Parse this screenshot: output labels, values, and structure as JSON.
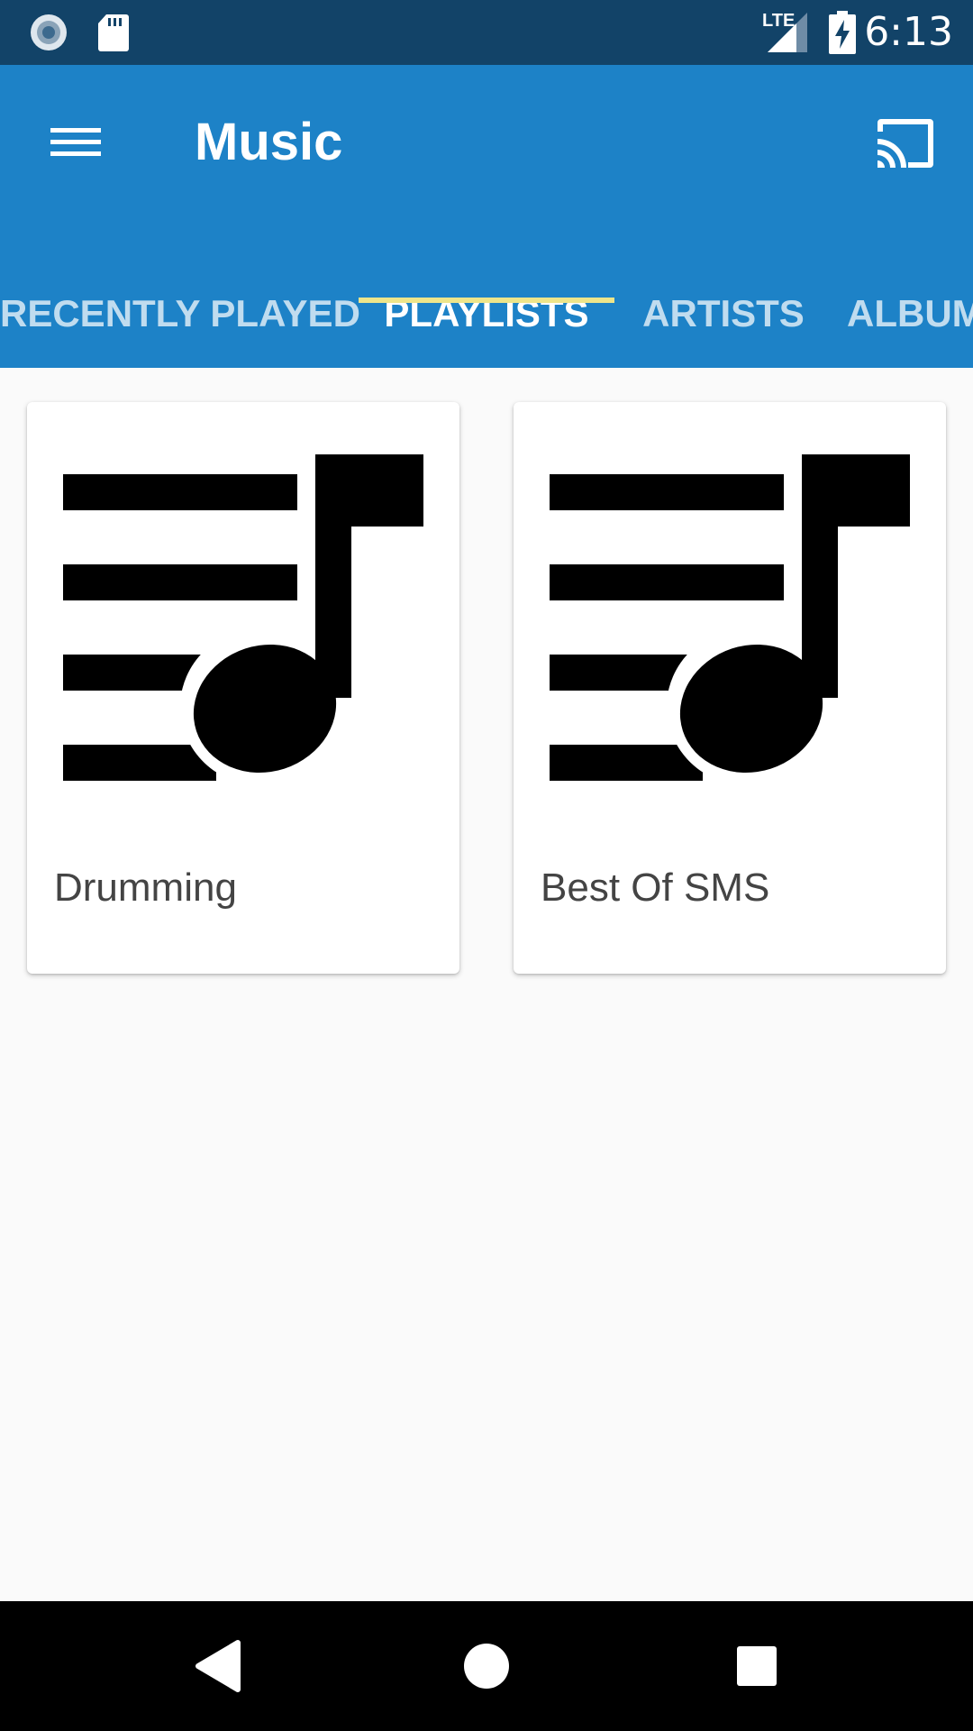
{
  "status_bar": {
    "time": "6:13",
    "network": "LTE",
    "icons": [
      "record-icon",
      "sd-card-icon",
      "lte-signal-icon",
      "battery-charging-icon"
    ]
  },
  "app_bar": {
    "title": "Music",
    "menu_icon": "hamburger-menu-icon",
    "cast_icon": "cast-icon",
    "color": "#1d82c7"
  },
  "tabs": [
    {
      "label": "RECENTLY PLAYED",
      "active": false
    },
    {
      "label": "PLAYLISTS",
      "active": true
    },
    {
      "label": "ARTISTS",
      "active": false
    },
    {
      "label": "ALBUMS",
      "active": false
    }
  ],
  "playlists": [
    {
      "name": "Drumming",
      "icon": "playlist-music-icon"
    },
    {
      "name": "Best Of SMS",
      "icon": "playlist-music-icon"
    }
  ],
  "nav_bar": {
    "icons": [
      "back-icon",
      "home-icon",
      "recents-icon"
    ]
  },
  "colors": {
    "status_bar": "#124368",
    "tab_indicator": "#eee58a",
    "background": "#fafafa"
  }
}
